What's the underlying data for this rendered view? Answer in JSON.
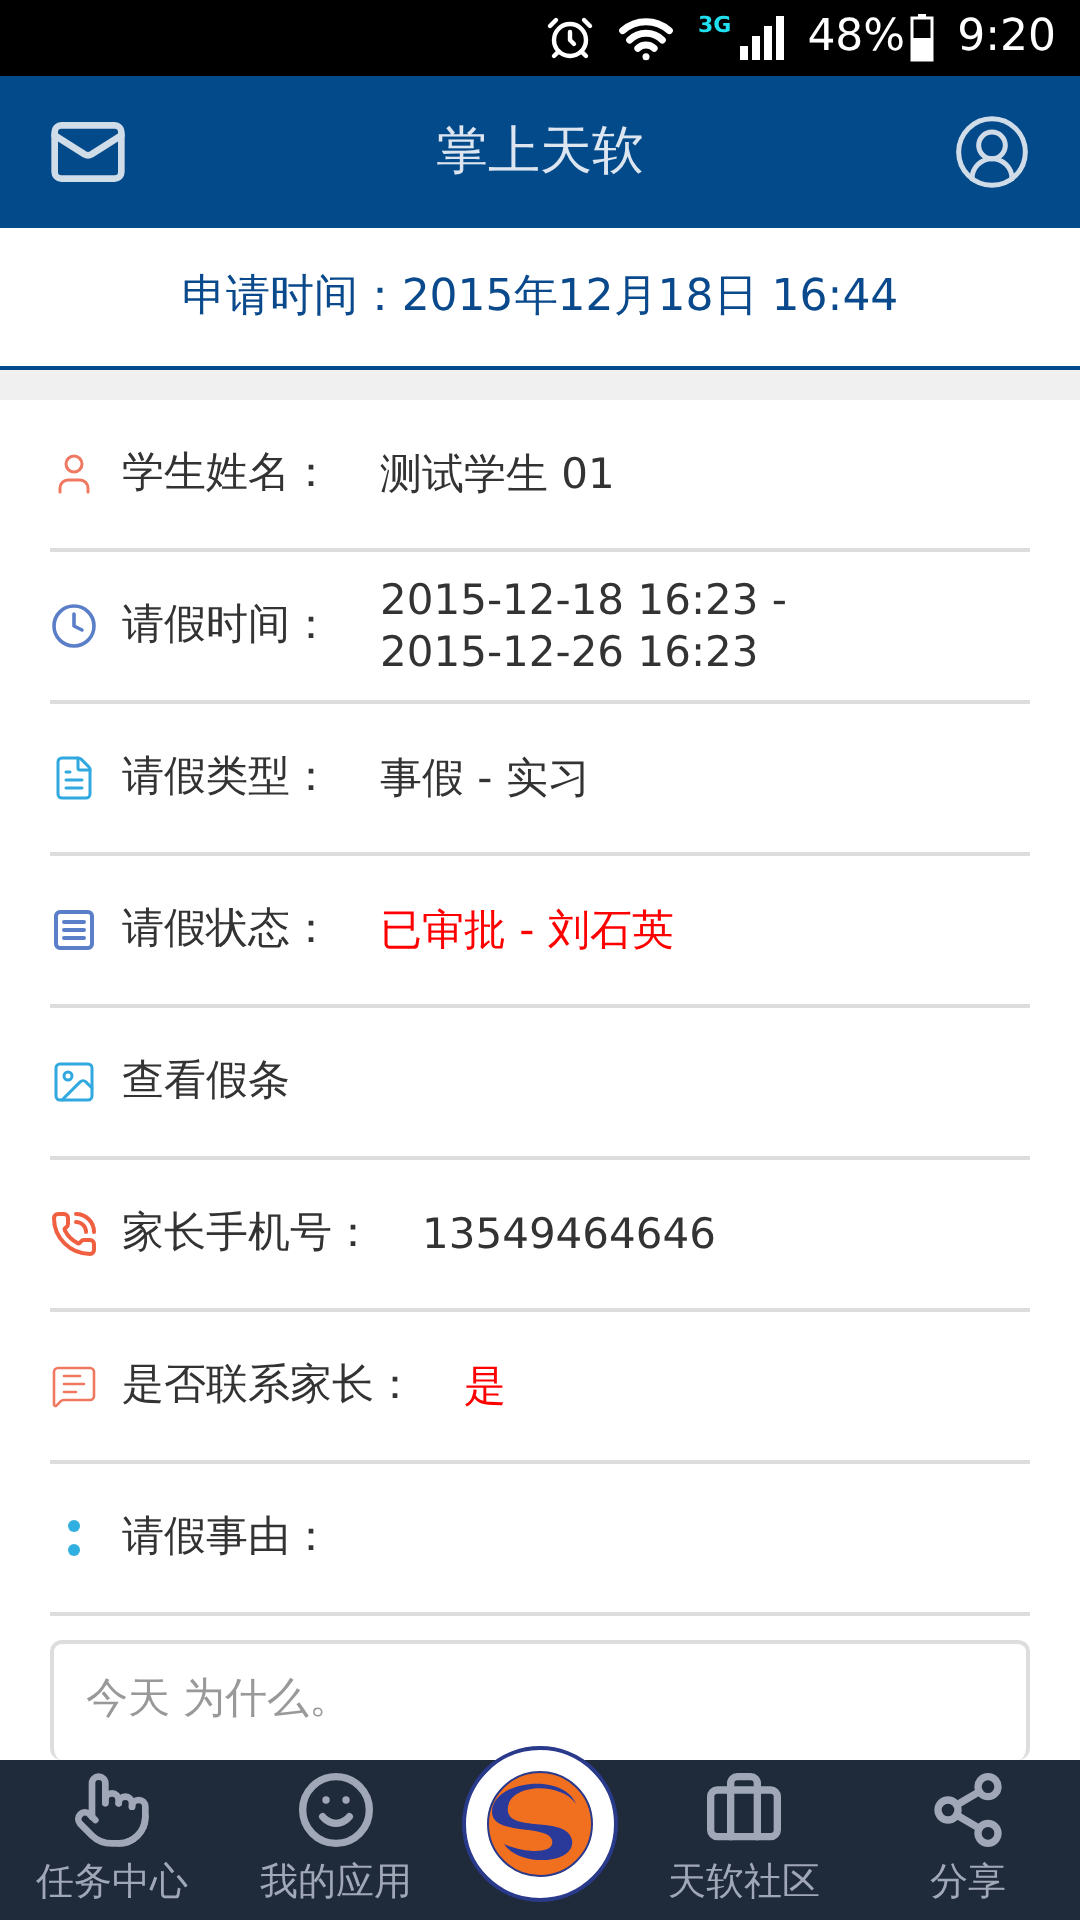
{
  "status_bar": {
    "network": "3G",
    "battery": "48%",
    "time": "9:20"
  },
  "header": {
    "title": "掌上天软"
  },
  "application_time": "申请时间：2015年12月18日 16:44",
  "fields": [
    {
      "kind": "person",
      "label": "学生姓名：",
      "lines": [
        "测试学生 01"
      ],
      "highlighted": false
    },
    {
      "kind": "clock",
      "label": "请假时间：",
      "lines": [
        "2015-12-18 16:23 -",
        "2015-12-26 16:23"
      ],
      "highlighted": false
    },
    {
      "kind": "document",
      "label": "请假类型：",
      "lines": [
        "事假 - 实习"
      ],
      "highlighted": false
    },
    {
      "kind": "list",
      "label": "请假状态：",
      "lines": [
        "已审批 - 刘石英"
      ],
      "highlighted": true
    },
    {
      "kind": "image",
      "label": "查看假条"
    },
    {
      "kind": "phone",
      "label": "家长手机号：",
      "lines": [
        "13549464646"
      ],
      "highlighted": false
    },
    {
      "kind": "message",
      "label": "是否联系家长：",
      "lines": [
        "是"
      ],
      "highlighted": true
    },
    {
      "kind": "dots",
      "label": "请假事由："
    }
  ],
  "reason": {
    "value": "今天 为什么。"
  },
  "bottom_nav": [
    {
      "kind": "hand",
      "label": "任务中心",
      "selected": false
    },
    {
      "kind": "smile",
      "label": "我的应用",
      "selected": false
    },
    {
      "kind": "logo"
    },
    {
      "kind": "briefcase",
      "label": "天软社区",
      "selected": false
    },
    {
      "kind": "share",
      "label": "分享",
      "selected": false
    }
  ]
}
